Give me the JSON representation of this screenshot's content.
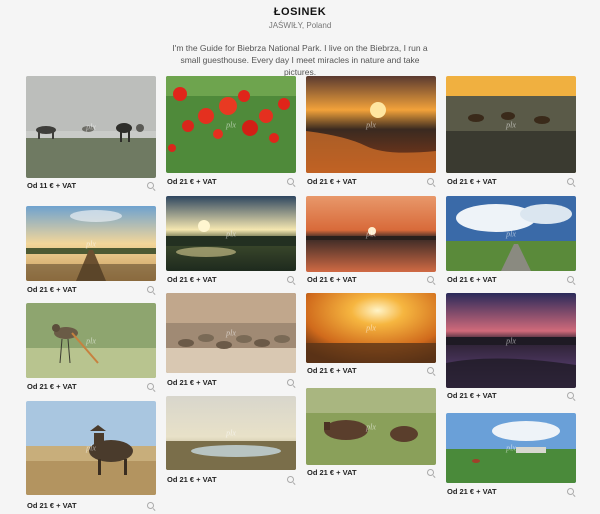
{
  "header": {
    "title": "ŁOSINEK",
    "location": "JAŚWIŁY, Poland",
    "description": "I'm the Guide for Biebrza National Park. I live on the Biebrza, I run a small guesthouse. Every day I meet miracles in nature and take pictures."
  },
  "watermark": "plx",
  "columns": [
    {
      "items": [
        {
          "price": "Od 11 € + VAT",
          "scene": "horses-fog"
        },
        {
          "price": "Od 21 € + VAT",
          "scene": "road-sunset"
        },
        {
          "price": "Od 21 € + VAT",
          "scene": "bird-godwit"
        },
        {
          "price": "Od 21 € + VAT",
          "scene": "moose-grass"
        }
      ]
    },
    {
      "items": [
        {
          "price": "Od 21 € + VAT",
          "scene": "poppies"
        },
        {
          "price": "Od 21 € + VAT",
          "scene": "river-clouds"
        },
        {
          "price": "Od 21 € + VAT",
          "scene": "geese-flock"
        },
        {
          "price": "Od 21 € + VAT",
          "scene": "marsh-haze"
        }
      ]
    },
    {
      "items": [
        {
          "price": "Od 21 € + VAT",
          "scene": "sunset-river"
        },
        {
          "price": "Od 21 € + VAT",
          "scene": "red-sunset"
        },
        {
          "price": "Od 21 € + VAT",
          "scene": "sun-glow"
        },
        {
          "price": "Od 21 € + VAT",
          "scene": "moose-pair"
        }
      ]
    },
    {
      "items": [
        {
          "price": "Od 21 € + VAT",
          "scene": "horses-meadow"
        },
        {
          "price": "Od 21 € + VAT",
          "scene": "blue-sky-road"
        },
        {
          "price": "Od 21 € + VAT",
          "scene": "purple-dusk"
        },
        {
          "price": "Od 21 € + VAT",
          "scene": "village-meadow"
        }
      ]
    }
  ]
}
